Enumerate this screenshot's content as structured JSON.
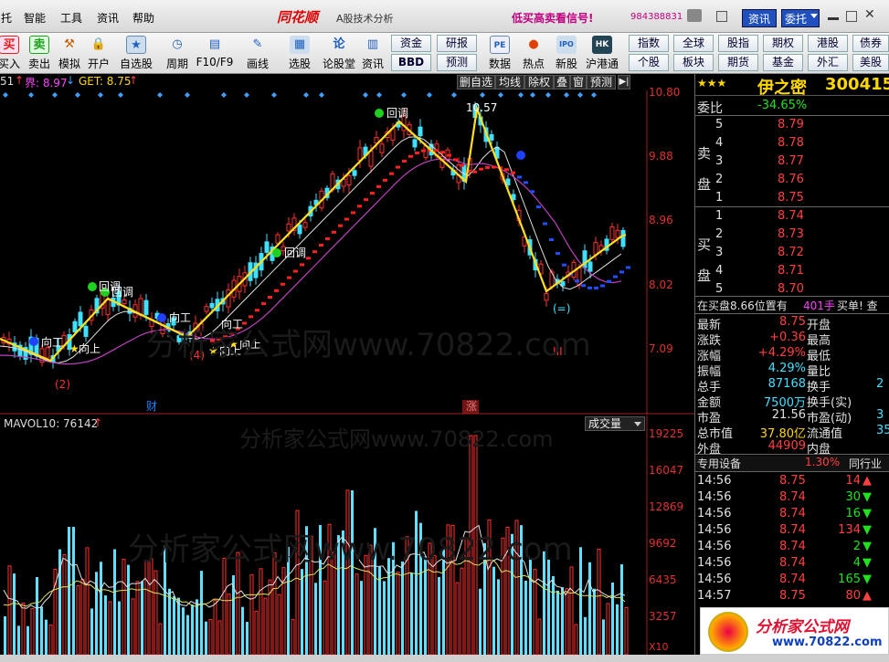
{
  "menubar": {
    "items": [
      "托",
      "智能",
      "工具",
      "资讯",
      "帮助"
    ],
    "logo": "同花顺",
    "logo_sub": "A股技术分析",
    "promo": "低买高卖看信号!",
    "phone": "984388831",
    "news_btn": "资讯",
    "order_btn": "委托"
  },
  "toolbar": {
    "tools": [
      {
        "label": "买入",
        "icon": "买",
        "color": "#e02020"
      },
      {
        "label": "卖出",
        "icon": "卖",
        "color": "#20a020"
      },
      {
        "label": "模拟",
        "icon": "⚒",
        "color": "#c06000"
      },
      {
        "label": "开户",
        "icon": "🔒",
        "color": "#e0a000"
      },
      {
        "label": "自选股",
        "icon": "★",
        "color": "#2060c0"
      },
      {
        "label": "周期",
        "icon": "◷",
        "color": "#2060c0"
      },
      {
        "label": "F10/F9",
        "icon": "▤",
        "color": "#2060c0"
      },
      {
        "label": "画线",
        "icon": "✎",
        "color": "#2060c0"
      },
      {
        "label": "选股",
        "icon": "▦",
        "color": "#2060c0"
      },
      {
        "label": "论股堂",
        "icon": "论",
        "color": "#2060c0"
      },
      {
        "label": "资讯",
        "icon": "▥",
        "color": "#2060c0"
      },
      {
        "label": "数据",
        "icon": "PE",
        "color": "#2060c0"
      },
      {
        "label": "热点",
        "icon": "●",
        "color": "#e04000"
      },
      {
        "label": "新股",
        "icon": "IPO",
        "color": "#2060c0"
      },
      {
        "label": "沪港通",
        "icon": "HK",
        "color": "#2060c0"
      }
    ],
    "quick": [
      "资金",
      "研报",
      "BBD",
      "预测",
      "指数",
      "全球",
      "股指",
      "期权",
      "港股",
      "债券",
      "个股",
      "板块",
      "期货",
      "基金",
      "外汇",
      "美股"
    ]
  },
  "infobar": {
    "prefix": "51",
    "jie_label": "界: 8.97",
    "get_label": "GET: 8.75"
  },
  "chart_tabs": [
    "删自选",
    "均线",
    "除权",
    "叠",
    "窗",
    "预测"
  ],
  "price_axis": [
    "10.80",
    "9.88",
    "8.96",
    "8.02",
    "7.09"
  ],
  "vol_axis": [
    "19225",
    "16047",
    "12869",
    "9692",
    "6435",
    "3257",
    "X10"
  ],
  "vol_indicator": "MAVOL10: 76142",
  "vol_mode": "成交量",
  "markers": {
    "peak": "10.57",
    "callback": "回调",
    "up": "向上",
    "up_work": "向工",
    "label2": "(2)",
    "label4": "(4)",
    "label_eq": "(=)",
    "label3": "III",
    "cai": "财",
    "zhang": "涨"
  },
  "watermark": "分析家公式网www.70822.com",
  "stock": {
    "stars": "★★★",
    "name": "伊之密",
    "code": "300415"
  },
  "order_book": {
    "ratio_label": "委比",
    "ratio": "-34.65%",
    "sell_label": "卖盘",
    "buy_label": "买盘",
    "sell": [
      {
        "lvl": "5",
        "price": "8.79"
      },
      {
        "lvl": "4",
        "price": "8.78"
      },
      {
        "lvl": "3",
        "price": "8.77"
      },
      {
        "lvl": "2",
        "price": "8.76"
      },
      {
        "lvl": "1",
        "price": "8.75"
      }
    ],
    "buy": [
      {
        "lvl": "1",
        "price": "8.74"
      },
      {
        "lvl": "2",
        "price": "8.73"
      },
      {
        "lvl": "3",
        "price": "8.72"
      },
      {
        "lvl": "4",
        "price": "8.71"
      },
      {
        "lvl": "5",
        "price": "8.70"
      }
    ]
  },
  "position": {
    "text": "在买盘8.66位置有",
    "qty": "401手",
    "tail": "买单! 查"
  },
  "quote": [
    {
      "l": "最新",
      "v": "8.75",
      "vc": "red",
      "r": "开盘"
    },
    {
      "l": "涨跌",
      "v": "+0.36",
      "vc": "red",
      "r": "最高"
    },
    {
      "l": "涨幅",
      "v": "+4.29%",
      "vc": "red",
      "r": "最低"
    },
    {
      "l": "振幅",
      "v": "4.29%",
      "vc": "cyan",
      "r": "量比"
    },
    {
      "l": "总手",
      "v": "87168",
      "vc": "cyan",
      "r": "换手"
    },
    {
      "l": "金额",
      "v": "7500万",
      "vc": "cyan",
      "r": "换手(实)"
    },
    {
      "l": "市盈",
      "v": "21.56",
      "vc": "white",
      "r": "市盈(动)"
    },
    {
      "l": "总市值",
      "v": "37.80亿",
      "vc": "yellow",
      "r": "流通值"
    },
    {
      "l": "外盘",
      "v": "44909",
      "vc": "red",
      "r": "内盘"
    }
  ],
  "quote_tail": [
    "",
    "",
    "",
    "",
    "2",
    "",
    "3",
    "35",
    ""
  ],
  "sector": {
    "name": "专用设备",
    "pct": "1.30%",
    "peer": "同行业"
  },
  "ticks": [
    {
      "t": "14:56",
      "p": "8.75",
      "pc": "red",
      "v": "14",
      "vc": "red",
      "a": "▲",
      "ac": "red"
    },
    {
      "t": "14:56",
      "p": "8.74",
      "pc": "red",
      "v": "30",
      "vc": "green",
      "a": "▼",
      "ac": "green"
    },
    {
      "t": "14:56",
      "p": "8.74",
      "pc": "red",
      "v": "16",
      "vc": "green",
      "a": "▼",
      "ac": "green"
    },
    {
      "t": "14:56",
      "p": "8.74",
      "pc": "red",
      "v": "134",
      "vc": "red",
      "a": "▼",
      "ac": "green"
    },
    {
      "t": "14:56",
      "p": "8.74",
      "pc": "red",
      "v": "2",
      "vc": "green",
      "a": "▼",
      "ac": "green"
    },
    {
      "t": "14:56",
      "p": "8.74",
      "pc": "red",
      "v": "4",
      "vc": "green",
      "a": "▼",
      "ac": "green"
    },
    {
      "t": "14:56",
      "p": "8.74",
      "pc": "red",
      "v": "165",
      "vc": "green",
      "a": "▼",
      "ac": "green"
    },
    {
      "t": "14:57",
      "p": "8.75",
      "pc": "red",
      "v": "80",
      "vc": "red",
      "a": "▲",
      "ac": "red"
    }
  ],
  "brand": {
    "name": "分析家公式网",
    "url": "www.70822.com"
  }
}
